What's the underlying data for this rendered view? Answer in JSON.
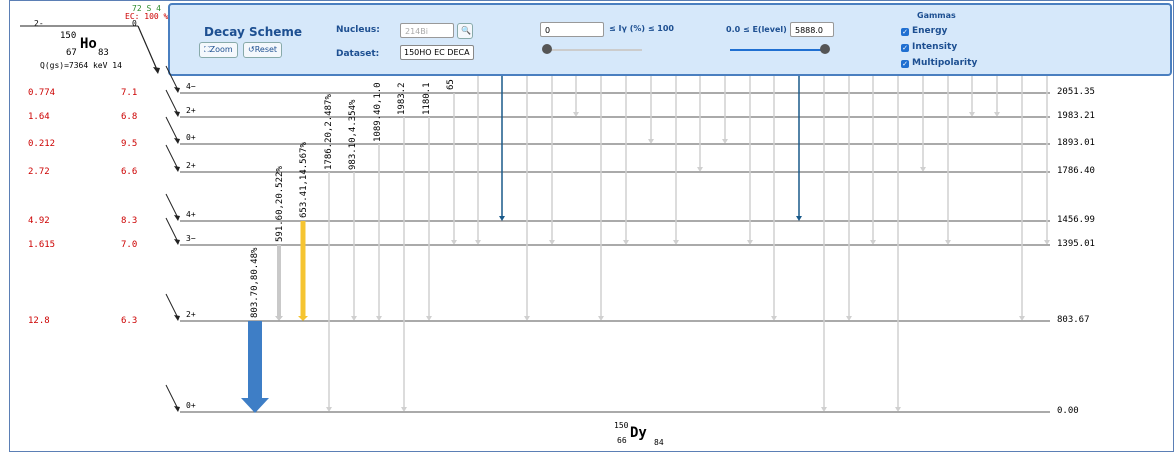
{
  "parent": {
    "half_life": "72 S 4",
    "decay_mode": "EC: 100 %",
    "spin": "2-",
    "level": "0",
    "mass": "150",
    "symbol": "Ho",
    "z": "67",
    "n": "83",
    "qvalue": "Q(gs)=7364 keV 14"
  },
  "toolbar": {
    "title": "Decay Scheme",
    "zoom_label": "Zoom",
    "reset_label": "Reset",
    "nucleus_label": "Nucleus:",
    "nucleus_placeholder": "214Bi",
    "dataset_label": "Dataset:",
    "dataset_value": "150HO EC DECA",
    "intensity_min": "0",
    "intensity_label": "≤ Iγ (%) ≤ 100",
    "energy_label": "0.0 ≤ E(level) ≤",
    "energy_max": "5888.0",
    "gammas_title": "Gammas",
    "check_energy": "Energy",
    "check_intensity": "Intensity",
    "check_multipolarity": "Multipolarity"
  },
  "levels": [
    {
      "spin": "4−",
      "energy": "2051.35",
      "ib": "0.774",
      "logft": "7.1"
    },
    {
      "spin": "2+",
      "energy": "1983.21",
      "ib": "1.64",
      "logft": "6.8"
    },
    {
      "spin": "0+",
      "energy": "1893.01",
      "ib": "0.212",
      "logft": "9.5"
    },
    {
      "spin": "2+",
      "energy": "1786.40",
      "ib": "2.72",
      "logft": "6.6"
    },
    {
      "spin": "4+",
      "energy": "1456.99",
      "ib": "4.92",
      "logft": "8.3"
    },
    {
      "spin": "3−",
      "energy": "1395.01",
      "ib": "1.615",
      "logft": "7.0"
    },
    {
      "spin": "2+",
      "energy": "803.67",
      "ib": "12.8",
      "logft": "6.3"
    },
    {
      "spin": "0+",
      "energy": "0.00",
      "ib": "",
      "logft": ""
    }
  ],
  "gamma_labels": [
    "803.70,80.48%",
    "591.60,20.522%",
    "653.41,14.567%",
    "1786.20,2.487%",
    "983.10,4.354%",
    "1089.40,1.0",
    "1983.2",
    "1180.1",
    "65"
  ],
  "daughter": {
    "mass": "150",
    "z": "66",
    "symbol": "Dy",
    "n": "84"
  },
  "colors": {
    "accent": "#1d4f91",
    "strong_gamma": "#3e7ec6",
    "yellow_gamma": "#f5c431",
    "dark_gamma": "#1a5a8a",
    "beta_red": "#cc0000"
  }
}
